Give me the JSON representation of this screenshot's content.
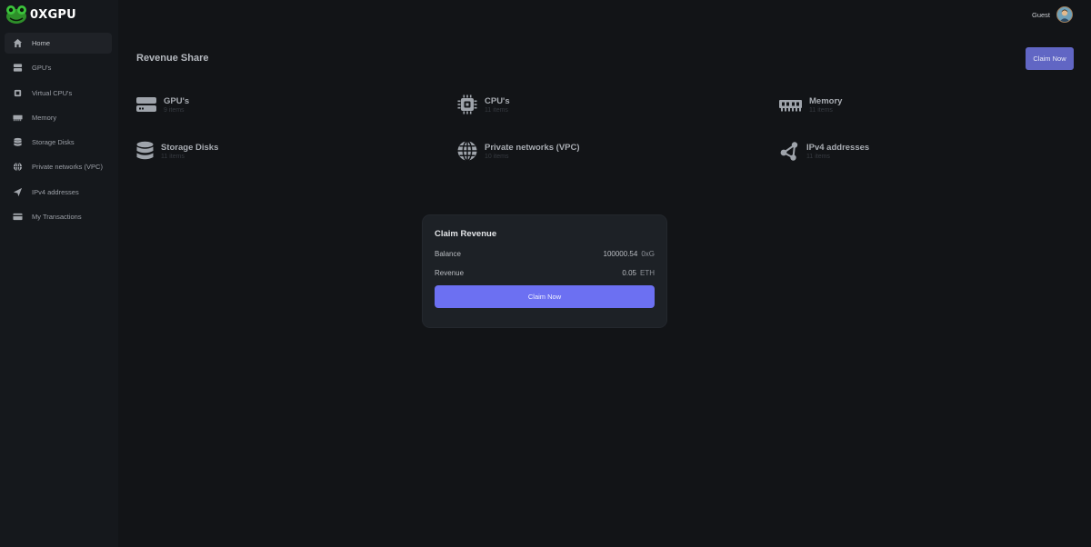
{
  "brand": {
    "name": "0XGPU",
    "logo_icon": "frog-logo-icon"
  },
  "user": {
    "name": "Guest",
    "avatar_icon": "user-avatar"
  },
  "sidebar": {
    "items": [
      {
        "label": "Home",
        "icon": "home-icon",
        "active": true
      },
      {
        "label": "GPU's",
        "icon": "server-icon"
      },
      {
        "label": "Virtual CPU's",
        "icon": "cpu-icon"
      },
      {
        "label": "Memory",
        "icon": "memory-icon"
      },
      {
        "label": "Storage Disks",
        "icon": "database-icon"
      },
      {
        "label": "Private networks (VPC)",
        "icon": "globe-icon"
      },
      {
        "label": "IPv4 addresses",
        "icon": "send-icon"
      },
      {
        "label": "My Transactions",
        "icon": "card-icon"
      }
    ]
  },
  "page": {
    "title": "Revenue Share",
    "claim_button": "Claim Now"
  },
  "resources": [
    {
      "title": "GPU's",
      "count": "9 items",
      "icon": "server-icon"
    },
    {
      "title": "CPU's",
      "count": "11 items",
      "icon": "cpu-icon"
    },
    {
      "title": "Memory",
      "count": "11 items",
      "icon": "memory-icon"
    },
    {
      "title": "Storage Disks",
      "count": "11 items",
      "icon": "database-icon"
    },
    {
      "title": "Private networks (VPC)",
      "count": "10 items",
      "icon": "globe-icon"
    },
    {
      "title": "IPv4 addresses",
      "count": "11 items",
      "icon": "nodes-icon"
    }
  ],
  "modal": {
    "title": "Claim Revenue",
    "balance_label": "Balance",
    "balance_value": "100000.54",
    "balance_unit": "0xG",
    "revenue_label": "Revenue",
    "revenue_value": "0.05",
    "revenue_unit": "ETH",
    "button": "Claim Now"
  },
  "colors": {
    "background": "#121417",
    "sidebar": "#15181c",
    "accent": "#6c70f2",
    "accent_muted": "#6166c4",
    "brand_green": "#3cc43c"
  }
}
